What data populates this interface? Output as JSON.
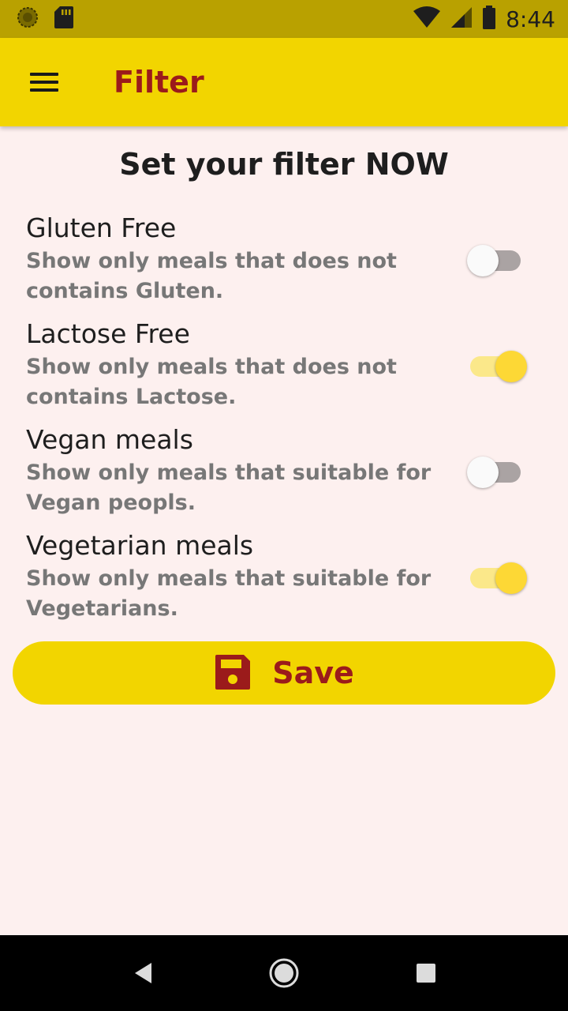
{
  "status_bar": {
    "time": "8:44",
    "icons": [
      "sync-icon",
      "sd-card-icon",
      "wifi-icon",
      "signal-icon",
      "battery-icon"
    ]
  },
  "app_bar": {
    "title": "Filter",
    "menu_icon": "menu-icon"
  },
  "page": {
    "heading": "Set your filter NOW"
  },
  "filters": [
    {
      "title": "Gluten Free",
      "description": "Show only meals that does not contains Gluten.",
      "enabled": false
    },
    {
      "title": "Lactose Free",
      "description": "Show only meals that does not contains Lactose.",
      "enabled": true
    },
    {
      "title": "Vegan meals",
      "description": "Show only meals that suitable for Vegan peopls.",
      "enabled": false
    },
    {
      "title": "Vegetarian meals",
      "description": "Show only meals that suitable for Vegetarians.",
      "enabled": true
    }
  ],
  "save_button": {
    "label": "Save",
    "icon": "floppy-disk-icon"
  },
  "colors": {
    "app_bar": "#f2d500",
    "status_bar": "#b9a100",
    "accent_text": "#9b1b1b",
    "background": "#fdf0ef",
    "switch_on_thumb": "#fdd835"
  },
  "nav_bar": {
    "icons": [
      "back-icon",
      "home-icon",
      "recents-icon"
    ]
  }
}
